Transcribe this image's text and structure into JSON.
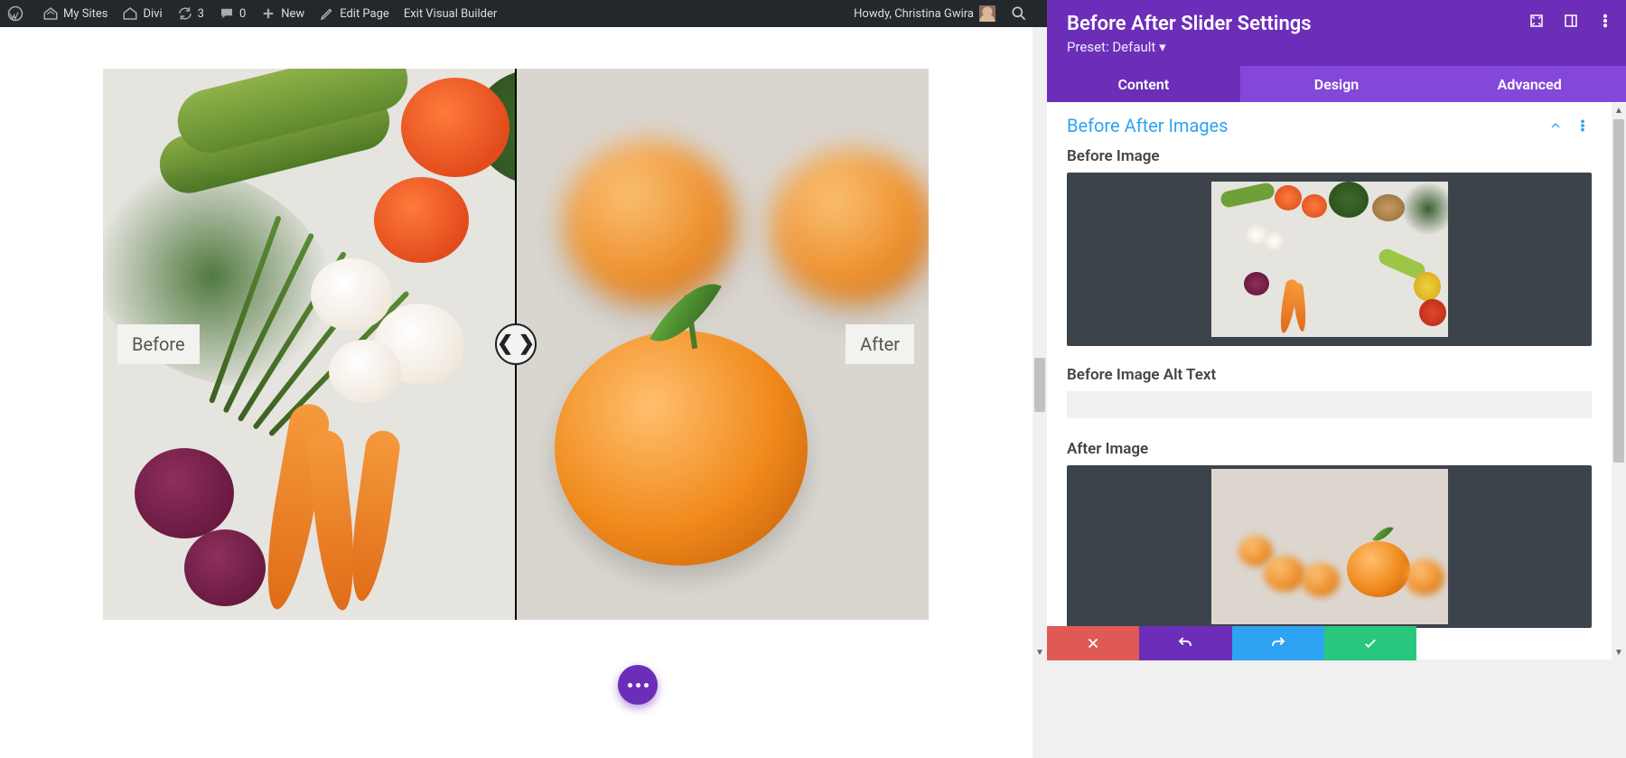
{
  "wp_admin_bar": {
    "my_sites": "My Sites",
    "site_name": "Divi",
    "updates_count": "3",
    "comments_count": "0",
    "new_label": "New",
    "edit_page": "Edit Page",
    "exit_vb": "Exit Visual Builder",
    "howdy": "Howdy, Christina Gwira"
  },
  "slider": {
    "before_label": "Before",
    "after_label": "After"
  },
  "panel": {
    "title": "Before After Slider Settings",
    "preset": "Preset: Default",
    "tabs": {
      "content": "Content",
      "design": "Design",
      "advanced": "Advanced"
    },
    "section_title": "Before After Images",
    "before_image_label": "Before Image",
    "before_alt_label": "Before Image Alt Text",
    "before_alt_value": "",
    "after_image_label": "After Image"
  }
}
